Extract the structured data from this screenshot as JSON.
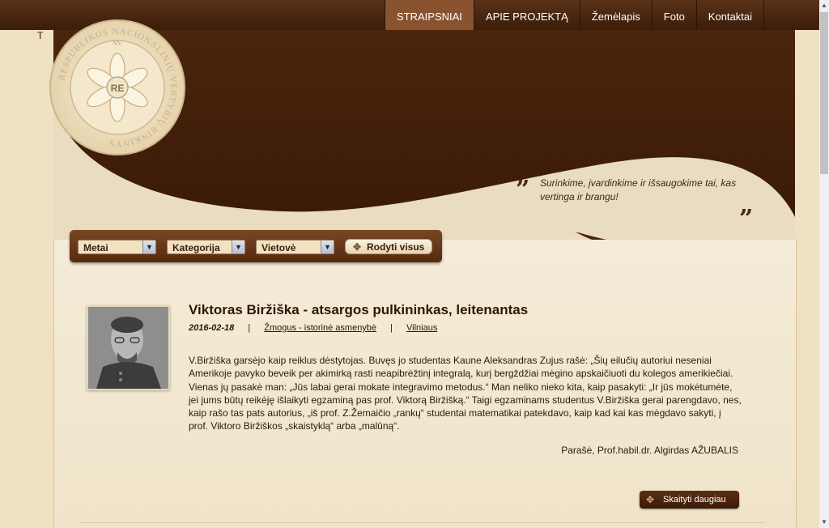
{
  "nav": {
    "items": [
      "STRAIPSNIAI",
      "APIE PROJEKTĄ",
      "Žemėlapis",
      "Foto",
      "Kontaktai"
    ],
    "active": "STRAIPSNIAI"
  },
  "logo": {
    "ring_text": "RESPUBLIKOS NACIONALINIŲ VERTYBIŲ RINKINYS",
    "top_mark": "NV",
    "center_mark": "RE"
  },
  "stray_char": "T",
  "quote": {
    "text": "Surinkime, įvardinkime ir išsaugokime tai, kas vertinga ir brangu!",
    "open_mark": "”",
    "close_mark": "”"
  },
  "filters": {
    "years": "Metai",
    "category": "Kategorija",
    "places": "Vietovė",
    "show_all": "Rodyti visus"
  },
  "article": {
    "title": "Viktoras Biržiška - atsargos pulkininkas, leitenantas",
    "date": "2016-02-18",
    "category": "Žmogus - istorinė asmenybė",
    "place": "Vilniaus",
    "separator": "|",
    "body": "V.Biržiška garsėjo kaip reiklus dėstytojas. Buvęs jo studentas Kaune Aleksandras Zujus rašė: „Šių eilučių autoriui neseniai Amerikoje pavyko beveik per akimirką rasti neapibrėžtinį integralą, kurį bergždžiai mėgino apskaičiuoti du kolegos amerikiečiai. Vienas jų pasakė man: „Jūs labai gerai mokate integravimo metodus.“ Man neliko nieko kita, kaip pasakyti: „Ir jūs mokėtumėte, jei jums būtų reikėję išlaikyti egzaminą pas prof. Viktorą Biržišką.“ Taigi egzaminams studentus V.Biržiška gerai parengdavo, nes, kaip rašo tas pats autorius, „iš prof. Z.Žemaičio „rankų“ studentai matematikai patekdavo, kaip kad kai kas mėgdavo sakyti, į prof. Viktoro Biržiškos „skaistyklą“ arba „malūną“.",
    "author": "Parašė,  Prof.habil.dr. Algirdas AŽUBALIS",
    "read_more": "Skaityti daugiau"
  },
  "colors": {
    "brown_dark": "#3b1d0a",
    "brown_nav_active": "#8a5330",
    "cream": "#e9dcc0"
  }
}
